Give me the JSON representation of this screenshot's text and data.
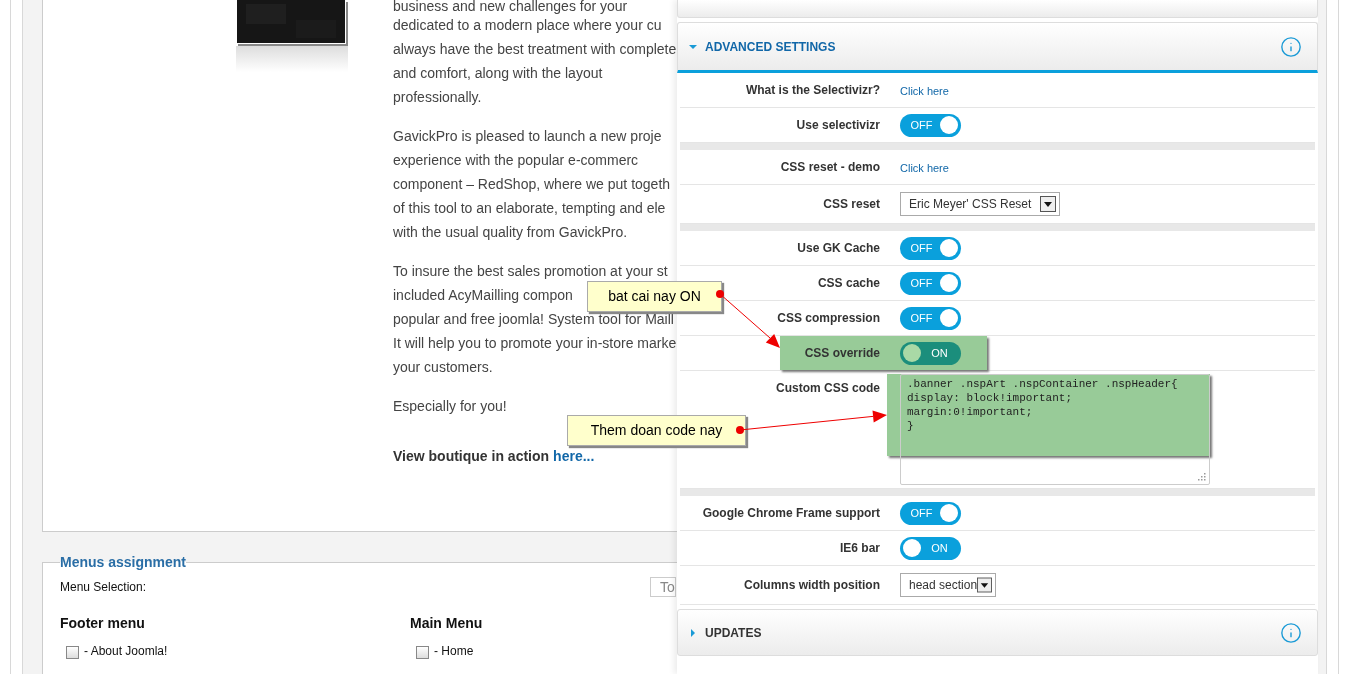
{
  "article": {
    "paragraphs": [
      {
        "lines": [
          "business and new challenges for your",
          "dedicated to a modern place where your cu",
          "always have the best treatment with complete",
          "and comfort, along with the layout",
          "professionally."
        ]
      },
      {
        "lines": [
          "GavickPro is pleased to launch a new proje",
          "experience with the popular e-commerc",
          "component – RedShop, where we put togeth",
          "of this tool to an elaborate, tempting and ele",
          "with the usual quality from GavickPro."
        ]
      },
      {
        "lines": [
          "To insure the best sales promotion at your st",
          "included AcyMailling compon",
          "popular and free joomla! System tool for Maill",
          "It will help you to promote your in-store marke",
          "your customers."
        ]
      },
      {
        "lines": [
          "Especially for you!"
        ]
      }
    ],
    "view_link": {
      "text": "View boutique in action",
      "link": "here..."
    }
  },
  "menus_assignment": {
    "legend": "Menus assignment",
    "menu_selection_label": "Menu Selection:",
    "filter_value": "To",
    "menus": [
      {
        "title": "Footer menu",
        "items": [
          {
            "label": "- About Joomla!",
            "checked": false
          }
        ]
      },
      {
        "title": "Main Menu",
        "items": [
          {
            "label": "- Home",
            "checked": false
          }
        ]
      }
    ]
  },
  "settings_panel": {
    "sections": [
      {
        "title": "ADVANCED SETTINGS",
        "expanded": true,
        "groups": [
          [
            {
              "kind": "link",
              "label": "What is the Selectivizr?",
              "value": "Click here",
              "highlighted": false
            },
            {
              "kind": "toggle",
              "label": "Use selectivizr",
              "on": false,
              "value": "OFF",
              "highlighted": false
            }
          ],
          [
            {
              "kind": "link",
              "label": "CSS reset - demo",
              "value": "Click here",
              "highlighted": false
            },
            {
              "kind": "select",
              "label": "CSS reset",
              "value": "Eric Meyer' CSS Reset",
              "highlighted": false
            }
          ],
          [
            {
              "kind": "toggle",
              "label": "Use GK Cache",
              "on": false,
              "value": "OFF",
              "highlighted": false
            },
            {
              "kind": "toggle",
              "label": "CSS cache",
              "on": false,
              "value": "OFF",
              "highlighted": false
            },
            {
              "kind": "toggle",
              "label": "CSS compression",
              "on": false,
              "value": "OFF",
              "highlighted": false
            },
            {
              "kind": "toggle",
              "label": "CSS override",
              "on": true,
              "value": "ON",
              "highlighted": true
            },
            {
              "kind": "code",
              "label": "Custom CSS code",
              "value": ".banner .nspArt .nspContainer .nspHeader{\ndisplay: block!important;\nmargin:0!important;\n}",
              "highlighted": true
            }
          ],
          [
            {
              "kind": "toggle",
              "label": "Google Chrome Frame support",
              "on": false,
              "value": "OFF",
              "highlighted": false
            },
            {
              "kind": "toggle",
              "label": "IE6 bar",
              "on": true,
              "value": "ON",
              "highlighted": false
            },
            {
              "kind": "select",
              "label": "Columns width position",
              "value": "head section",
              "highlighted": false
            }
          ]
        ]
      },
      {
        "title": "UPDATES",
        "expanded": false
      }
    ]
  },
  "annotations": [
    {
      "text": "bat cai nay ON"
    },
    {
      "text": "Them doan code nay"
    }
  ]
}
